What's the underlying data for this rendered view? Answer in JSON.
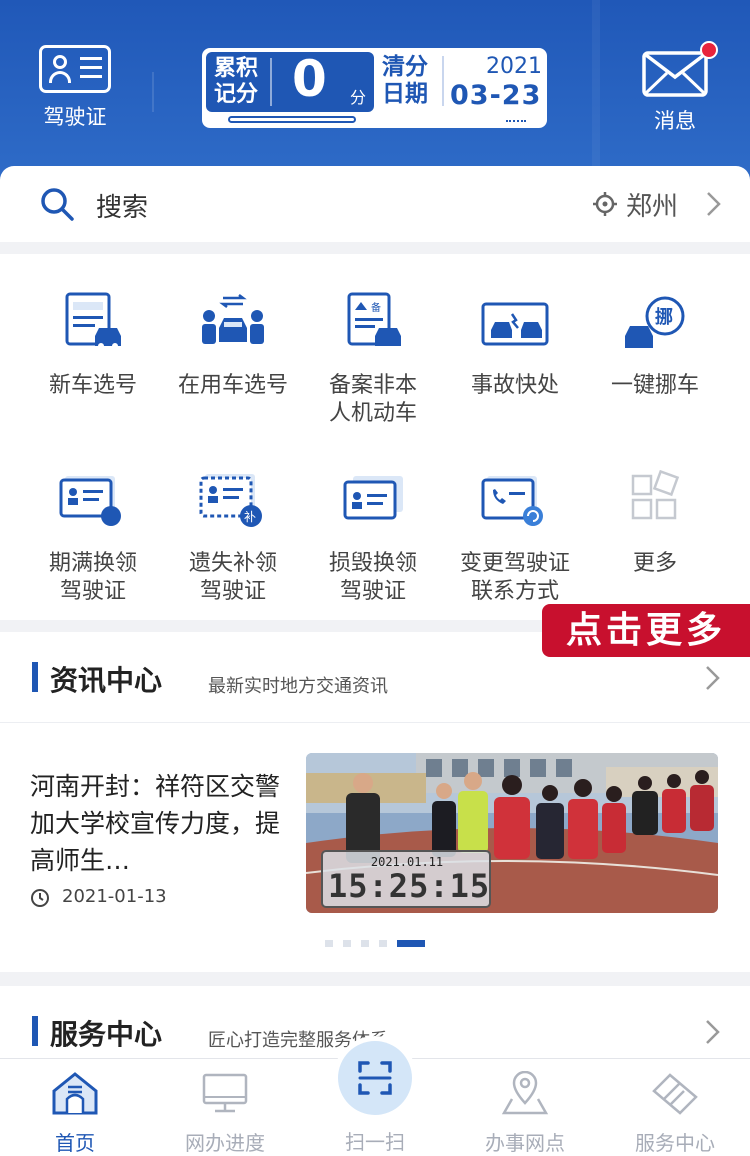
{
  "header": {
    "license_label": "驾驶证",
    "message_label": "消息",
    "score": {
      "caption_line1": "累积",
      "caption_line2": "记分",
      "value": "0",
      "unit": "分",
      "clear_caption_line1": "清分",
      "clear_caption_line2": "日期",
      "clear_year": "2021",
      "clear_date": "03-23"
    }
  },
  "search": {
    "label": "搜索",
    "location": "郑州"
  },
  "grid": {
    "items": [
      {
        "label": "新车选号",
        "icon": "new-car-plate-icon"
      },
      {
        "label": "在用车选号",
        "icon": "used-car-plate-icon"
      },
      {
        "label": "备案非本\n人机动车",
        "icon": "register-vehicle-icon"
      },
      {
        "label": "事故快处",
        "icon": "accident-quick-icon"
      },
      {
        "label": "一键挪车",
        "icon": "move-car-icon"
      },
      {
        "label": "期满换领\n驾驶证",
        "icon": "renew-license-icon"
      },
      {
        "label": "遗失补领\n驾驶证",
        "icon": "reissue-license-icon"
      },
      {
        "label": "损毁换领\n驾驶证",
        "icon": "damaged-license-icon"
      },
      {
        "label": "变更驾驶证\n联系方式",
        "icon": "change-contact-icon"
      },
      {
        "label": "更多",
        "icon": "more-icon"
      }
    ]
  },
  "promo": {
    "label": "点击更多"
  },
  "news": {
    "title": "资讯中心",
    "subtitle": "最新实时地方交通资讯",
    "article_title": "河南开封：祥符区交警加大学校宣传力度，提高师生…",
    "article_date": "2021-01-13",
    "photo_date_stamp": "2021.01.11",
    "photo_time_stamp": "15:25:15"
  },
  "services": {
    "title": "服务中心",
    "subtitle": "匠心打造完整服务体系"
  },
  "bottom_nav": {
    "items": [
      {
        "label": "首页",
        "icon": "home-icon"
      },
      {
        "label": "网办进度",
        "icon": "monitor-icon"
      },
      {
        "label": "扫一扫",
        "icon": "scan-icon"
      },
      {
        "label": "办事网点",
        "icon": "location-pin-icon"
      },
      {
        "label": "服务中心",
        "icon": "handshake-icon"
      }
    ]
  },
  "colors": {
    "brand_blue": "#1f57b4",
    "header_blue": "#2058b8",
    "promo_red": "#c8102e",
    "notification_red": "#e8243c"
  }
}
